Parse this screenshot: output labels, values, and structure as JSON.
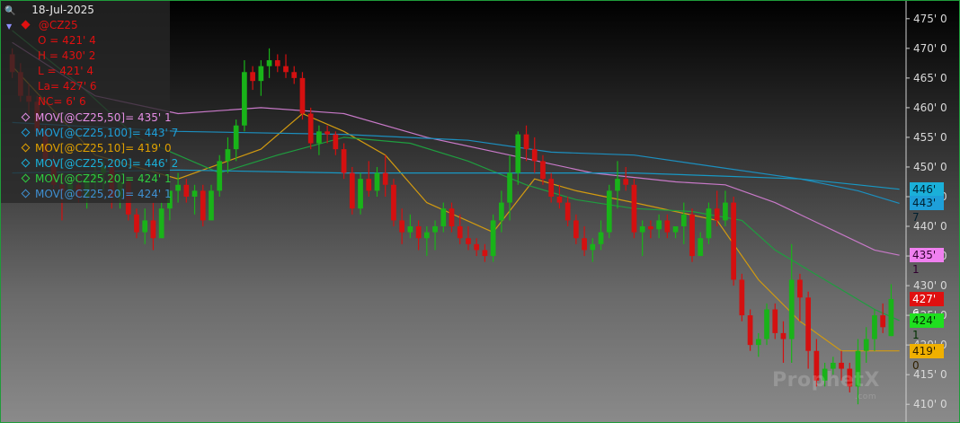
{
  "header": {
    "date": "18-Jul-2025",
    "symbol": "@CZ25",
    "open": "O = 421' 4",
    "high": "H = 430' 2",
    "low": "L = 421' 4",
    "last": "La= 427' 6",
    "net_change": "NC= 6' 6"
  },
  "indicators": [
    {
      "label": "MOV[@CZ25,50]= 435' 1",
      "color": "#e58ee5"
    },
    {
      "label": "MOV[@CZ25,100]= 443' 7",
      "color": "#1e9fd9"
    },
    {
      "label": "MOV[@CZ25,10]= 419' 0",
      "color": "#e0a000"
    },
    {
      "label": "MOV[@CZ25,200]= 446' 2",
      "color": "#1ab0d9"
    },
    {
      "label": "MOV[@CZ25,20]= 424' 1",
      "color": "#2ecc40"
    },
    {
      "label": "MOV[@CZ25,20]= 424' 1",
      "color": "#3f8fd0"
    }
  ],
  "price_tags": [
    {
      "text": "446' 2",
      "value": 446.25,
      "bg": "#1ab0d9",
      "fg": "#002030"
    },
    {
      "text": "443' 7",
      "value": 443.875,
      "bg": "#1e9fd9",
      "fg": "#002030"
    },
    {
      "text": "435' 1",
      "value": 435.125,
      "bg": "#f080f0",
      "fg": "#300030"
    },
    {
      "text": "427' 6",
      "value": 427.75,
      "bg": "#e01010",
      "fg": "#ffffff"
    },
    {
      "text": "424' 1",
      "value": 424.125,
      "bg": "#1fe01f",
      "fg": "#003000"
    },
    {
      "text": "419' 0",
      "value": 419.0,
      "bg": "#f0b000",
      "fg": "#302000"
    }
  ],
  "watermark": {
    "brand": "ProphetX",
    "sub": ".com"
  },
  "chart_data": {
    "type": "candlestick",
    "symbol": "@CZ25",
    "ylim": [
      407,
      478
    ],
    "y_ticks": [
      {
        "v": 475,
        "label": "475' 0"
      },
      {
        "v": 470,
        "label": "470' 0"
      },
      {
        "v": 465,
        "label": "465' 0"
      },
      {
        "v": 460,
        "label": "460' 0"
      },
      {
        "v": 455,
        "label": "455' 0"
      },
      {
        "v": 450,
        "label": "450' 0"
      },
      {
        "v": 445,
        "label": "445' 0"
      },
      {
        "v": 440,
        "label": "440' 0"
      },
      {
        "v": 435,
        "label": "435' 0"
      },
      {
        "v": 430,
        "label": "430' 0"
      },
      {
        "v": 425,
        "label": "425' 0"
      },
      {
        "v": 420,
        "label": "420' 0"
      },
      {
        "v": 415,
        "label": "415' 0"
      },
      {
        "v": 410,
        "label": "410' 0"
      }
    ],
    "colors": {
      "up": "#19b319",
      "down": "#d41010",
      "up_wick": "#19b319",
      "down_wick": "#d41010"
    },
    "candles": [
      [
        469,
        470,
        465,
        466
      ],
      [
        466,
        467.5,
        461,
        462
      ],
      [
        462,
        464,
        459,
        461
      ],
      [
        461,
        462,
        455,
        456
      ],
      [
        456,
        457,
        450,
        451
      ],
      [
        451,
        452,
        446,
        447
      ],
      [
        447,
        449,
        441,
        446
      ],
      [
        446,
        448,
        445,
        447
      ],
      [
        447,
        449,
        444,
        445
      ],
      [
        445,
        449,
        443,
        448
      ],
      [
        448,
        450,
        445,
        449
      ],
      [
        449,
        451,
        446,
        450
      ],
      [
        450,
        452,
        443,
        445
      ],
      [
        445,
        449,
        443,
        447.5
      ],
      [
        447.5,
        448,
        441,
        442
      ],
      [
        442,
        443,
        438,
        439
      ],
      [
        439,
        443,
        437,
        441
      ],
      [
        441,
        444,
        436,
        438
      ],
      [
        438,
        444,
        440,
        443
      ],
      [
        443,
        446,
        441,
        446
      ],
      [
        446,
        449,
        444,
        447
      ],
      [
        447,
        448,
        444,
        445
      ],
      [
        445,
        447,
        442,
        446
      ],
      [
        446,
        447,
        440,
        441
      ],
      [
        441,
        447,
        444,
        446
      ],
      [
        446,
        452,
        445,
        451
      ],
      [
        451,
        455,
        449,
        453
      ],
      [
        453,
        458,
        451,
        457
      ],
      [
        457,
        468,
        456,
        466
      ],
      [
        466,
        467,
        463,
        464.5
      ],
      [
        464.5,
        468,
        462,
        467
      ],
      [
        467,
        470,
        465,
        468
      ],
      [
        468,
        469,
        466,
        467
      ],
      [
        467,
        469,
        465,
        466
      ],
      [
        466,
        467,
        464,
        465
      ],
      [
        465,
        466,
        458,
        459
      ],
      [
        459,
        460,
        453,
        454
      ],
      [
        454,
        457,
        452,
        456
      ],
      [
        456,
        457,
        454,
        455.5
      ],
      [
        455.5,
        456,
        452,
        453
      ],
      [
        453,
        454,
        448,
        449
      ],
      [
        449,
        450,
        442,
        443
      ],
      [
        443,
        449,
        442,
        448
      ],
      [
        448,
        451,
        445,
        446
      ],
      [
        446,
        450,
        445,
        449
      ],
      [
        449,
        452,
        445,
        447
      ],
      [
        447,
        448,
        440,
        441
      ],
      [
        441,
        443,
        437,
        439
      ],
      [
        439,
        442,
        438,
        440
      ],
      [
        440,
        441,
        436,
        438
      ],
      [
        438,
        440,
        435,
        439
      ],
      [
        439,
        441,
        436,
        440
      ],
      [
        440,
        444,
        439,
        443
      ],
      [
        443,
        444,
        439,
        440
      ],
      [
        440,
        442,
        437,
        438
      ],
      [
        438,
        440,
        436,
        437
      ],
      [
        437,
        438,
        435,
        436
      ],
      [
        436,
        437,
        434,
        435
      ],
      [
        435,
        442,
        434,
        441
      ],
      [
        441,
        446,
        439,
        444
      ],
      [
        444,
        452,
        441,
        449
      ],
      [
        449,
        456,
        447,
        455.5
      ],
      [
        455.5,
        457,
        451,
        453
      ],
      [
        453,
        455,
        449,
        451
      ],
      [
        451,
        452,
        447,
        448
      ],
      [
        448,
        449,
        444,
        445
      ],
      [
        445,
        447,
        443,
        444
      ],
      [
        444,
        445,
        440,
        441
      ],
      [
        441,
        442,
        437,
        438
      ],
      [
        438,
        440,
        435,
        436
      ],
      [
        436,
        438,
        434,
        437
      ],
      [
        437,
        441,
        436,
        439
      ],
      [
        439,
        447,
        438,
        446
      ],
      [
        446,
        451,
        443,
        448
      ],
      [
        448,
        450,
        446,
        447
      ],
      [
        447,
        448,
        438,
        439
      ],
      [
        439,
        441,
        435,
        440
      ],
      [
        440,
        441,
        438,
        439.5
      ],
      [
        439.5,
        442,
        438,
        441
      ],
      [
        441,
        442,
        438,
        439
      ],
      [
        439,
        440,
        438,
        440
      ],
      [
        440,
        444,
        437,
        442
      ],
      [
        442,
        443,
        434,
        435
      ],
      [
        435,
        439,
        435,
        438
      ],
      [
        438,
        444,
        437,
        443
      ],
      [
        443,
        446,
        440,
        441
      ],
      [
        441,
        446,
        440,
        444
      ],
      [
        444,
        445,
        430,
        431
      ],
      [
        431,
        432,
        424,
        425
      ],
      [
        425,
        426,
        419,
        420
      ],
      [
        420,
        422,
        418,
        421
      ],
      [
        421,
        427,
        420,
        426
      ],
      [
        426,
        427,
        421,
        422
      ],
      [
        422,
        424,
        417,
        421
      ],
      [
        421,
        437,
        417,
        431
      ],
      [
        431,
        432,
        424,
        428
      ],
      [
        428,
        429,
        416,
        419
      ],
      [
        419,
        421,
        413,
        414
      ],
      [
        414,
        417,
        413,
        416
      ],
      [
        416,
        418,
        415,
        417
      ],
      [
        417,
        419,
        414,
        416
      ],
      [
        416,
        417,
        412,
        413
      ],
      [
        413,
        421,
        410,
        419
      ],
      [
        419,
        423,
        417,
        421
      ],
      [
        421,
        426,
        419,
        425
      ],
      [
        425,
        427,
        422,
        423
      ],
      [
        421.5,
        430.25,
        421.5,
        427.75
      ]
    ],
    "moving_averages": [
      {
        "name": "MOV[@CZ25,10]",
        "color": "#d29a10",
        "points": [
          [
            0,
            467
          ],
          [
            10,
            452
          ],
          [
            20,
            448
          ],
          [
            30,
            453
          ],
          [
            35,
            459
          ],
          [
            40,
            456
          ],
          [
            45,
            452
          ],
          [
            50,
            444
          ],
          [
            58,
            439
          ],
          [
            63,
            448
          ],
          [
            68,
            446
          ],
          [
            75,
            444
          ],
          [
            85,
            441
          ],
          [
            90,
            431
          ],
          [
            95,
            424
          ],
          [
            100,
            419
          ],
          [
            107,
            419
          ]
        ]
      },
      {
        "name": "MOV[@CZ25,20]",
        "color": "#1f9d3f",
        "points": [
          [
            0,
            473
          ],
          [
            8,
            464
          ],
          [
            15,
            455
          ],
          [
            25,
            449
          ],
          [
            32,
            452
          ],
          [
            40,
            455
          ],
          [
            48,
            454
          ],
          [
            55,
            451
          ],
          [
            62,
            447
          ],
          [
            68,
            444.5
          ],
          [
            75,
            443
          ],
          [
            82,
            442.5
          ],
          [
            88,
            441
          ],
          [
            92,
            436
          ],
          [
            98,
            431
          ],
          [
            104,
            426
          ],
          [
            107,
            424.125
          ]
        ]
      },
      {
        "name": "MOV[@CZ25,50]",
        "color": "#c879c8",
        "points": [
          [
            0,
            471
          ],
          [
            10,
            462
          ],
          [
            20,
            459
          ],
          [
            30,
            460
          ],
          [
            40,
            459
          ],
          [
            50,
            455
          ],
          [
            60,
            452
          ],
          [
            70,
            449
          ],
          [
            80,
            447.5
          ],
          [
            86,
            447
          ],
          [
            92,
            444
          ],
          [
            98,
            440
          ],
          [
            104,
            436
          ],
          [
            107,
            435.125
          ]
        ]
      },
      {
        "name": "MOV[@CZ25,100]",
        "color": "#1c8fbf",
        "points": [
          [
            0,
            457.5
          ],
          [
            20,
            456
          ],
          [
            40,
            455.5
          ],
          [
            55,
            454.5
          ],
          [
            65,
            452.5
          ],
          [
            75,
            452
          ],
          [
            85,
            450
          ],
          [
            95,
            448
          ],
          [
            102,
            446
          ],
          [
            107,
            443.875
          ]
        ]
      },
      {
        "name": "MOV[@CZ25,200]",
        "color": "#1898c4",
        "points": [
          [
            0,
            449
          ],
          [
            20,
            449.5
          ],
          [
            40,
            449
          ],
          [
            60,
            449
          ],
          [
            75,
            449
          ],
          [
            85,
            448.5
          ],
          [
            95,
            448
          ],
          [
            102,
            447
          ],
          [
            107,
            446.25
          ]
        ]
      }
    ]
  }
}
